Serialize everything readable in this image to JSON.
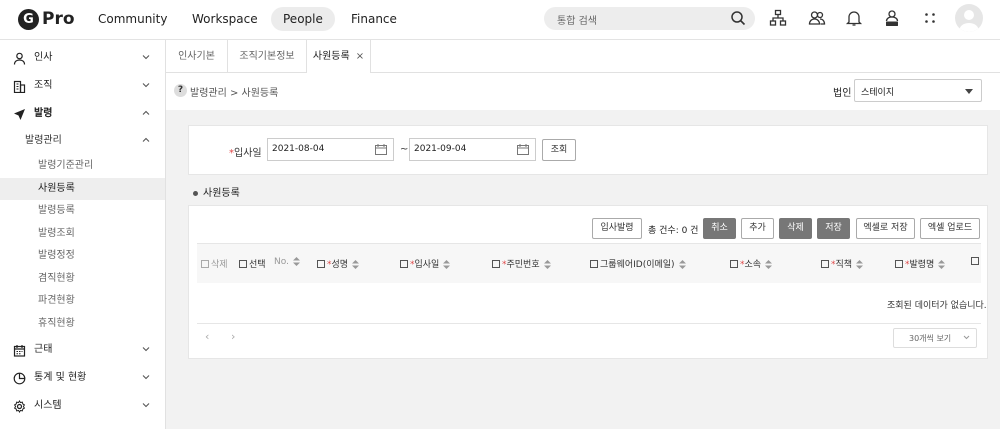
{
  "app": {
    "logo_letter": "G",
    "logo_text": "Pro"
  },
  "nav": {
    "tabs": [
      "Community",
      "Workspace",
      "People",
      "Finance"
    ],
    "active": "People"
  },
  "search": {
    "placeholder": "통합 검색"
  },
  "sidebar": {
    "items": [
      {
        "label": "인사",
        "icon": "person-icon"
      },
      {
        "label": "조직",
        "icon": "building-icon"
      },
      {
        "label": "발령",
        "icon": "send-icon"
      }
    ],
    "group_label": "발령관리",
    "sub_items": [
      "발령기준관리",
      "사원등록",
      "발령등록",
      "발령조회",
      "발령정정",
      "겸직현황",
      "파견현황",
      "휴직현황"
    ],
    "active_sub": "사원등록",
    "bottom_items": [
      {
        "label": "근태",
        "icon": "calendar-icon"
      },
      {
        "label": "통계 및 현황",
        "icon": "chart-icon"
      },
      {
        "label": "시스템",
        "icon": "gear-icon"
      }
    ]
  },
  "content_tabs": [
    "인사기본",
    "조직기본정보",
    "사원등록"
  ],
  "breadcrumb": {
    "help": "?",
    "text": "발령관리 > 사원등록"
  },
  "corp": {
    "label": "법인",
    "value": "스테이지"
  },
  "filter": {
    "label_required": "*",
    "label": "입사일",
    "date_from": "2021-08-04",
    "tilde": "~",
    "date_to": "2021-09-04",
    "search_button": "조회"
  },
  "section_title": "사원등록",
  "toolbar": {
    "hire_button": "입사발령",
    "total": "총 건수: 0 건",
    "cancel_button": "취소",
    "add_button": "추가",
    "delete_button": "삭제",
    "save_button": "저장",
    "excel_save_button": "엑셀로 저장",
    "excel_upload_button": "엑셀 업로드"
  },
  "table": {
    "columns": {
      "delete": "삭제",
      "select": "선택",
      "no": "No.",
      "name": "성명",
      "hire_date": "입사일",
      "resident_no": "주민번호",
      "groupware_id": "그룹웨어ID(이메일)",
      "dept": "소속",
      "position": "직책",
      "order_name": "발령명"
    },
    "required_mark": "*",
    "empty_message": "조회된 데이터가 없습니다."
  },
  "pagination": {
    "prev": "‹",
    "next": "›",
    "per_page": "30개씩 보기"
  }
}
